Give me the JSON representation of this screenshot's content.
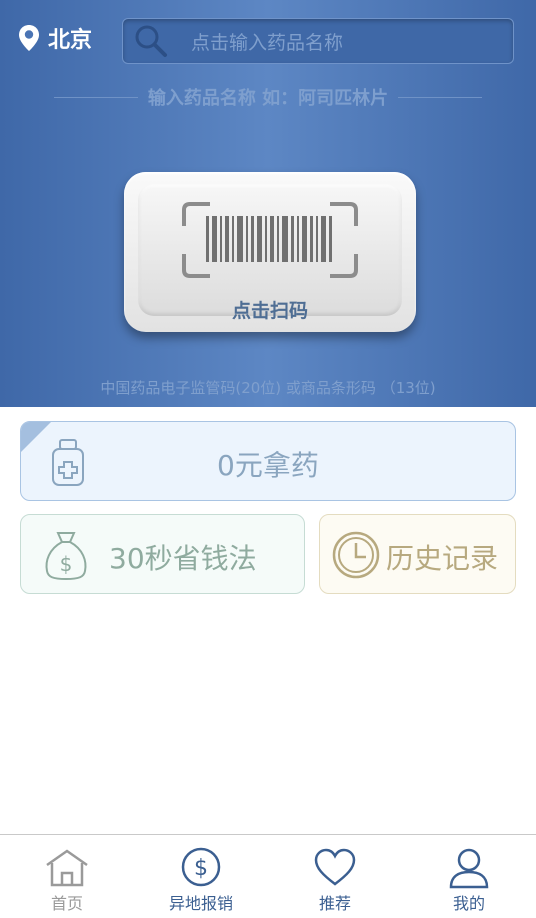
{
  "header": {
    "city": "北京",
    "search_placeholder": "点击输入药品名称",
    "hint": "输入药品名称  如：阿司匹林片"
  },
  "scan": {
    "label": "点击扫码",
    "codes_hint": "中国药品电子监管码(20位) 或商品条形码 （13位)"
  },
  "cards": {
    "free_medicine": "0元拿药",
    "save_money": "30秒省钱法",
    "history": "历史记录"
  },
  "tabbar": {
    "items": [
      {
        "label": "首页",
        "icon": "home-icon"
      },
      {
        "label": "异地报销",
        "icon": "dollar-icon"
      },
      {
        "label": "推荐",
        "icon": "heart-icon"
      },
      {
        "label": "我的",
        "icon": "user-icon"
      }
    ]
  },
  "colors": {
    "header_blue": "#4a74b4",
    "card_blue": "#8aa5bf",
    "card_green": "#8fab9f",
    "card_gold": "#b7a97f",
    "tab_active": "#3b5f91",
    "tab_inactive": "#9a9a9a"
  }
}
